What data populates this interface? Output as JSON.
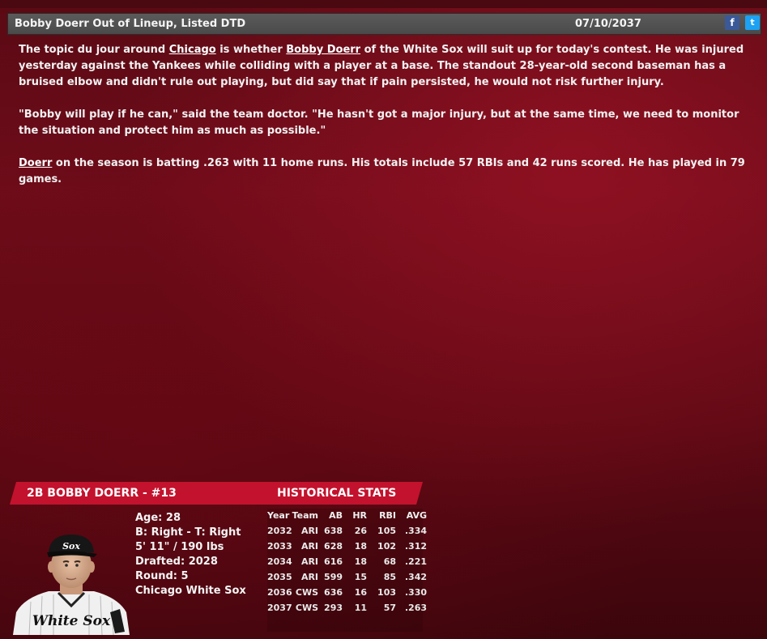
{
  "headline": {
    "title": "Bobby Doerr Out of Lineup, Listed DTD",
    "date": "07/10/2037",
    "facebook_icon": "f",
    "twitter_icon": "t"
  },
  "article": {
    "p1_a": "The topic du jour around ",
    "p1_link1": "Chicago",
    "p1_b": " is whether ",
    "p1_link2": "Bobby Doerr",
    "p1_c": " of the White Sox will suit up for today's contest. He was injured yesterday against the Yankees while colliding with a player at a base. The standout 28-year-old second baseman has a bruised elbow and didn't rule out playing, but did say that if pain persisted, he would not risk further injury.",
    "p2": "\"Bobby will play if he can,\" said the team doctor. \"He hasn't got a major injury, but at the same time, we need to monitor the situation and protect him as much as possible.\"",
    "p3_link": "Doerr",
    "p3_rest": " on the season is batting .263 with 11 home runs. His totals include 57 RBIs and 42 runs scored. He has played in 79 games."
  },
  "player_card": {
    "name_header": "2B BOBBY DOERR - #13",
    "stats_header": "HISTORICAL STATS",
    "bio": {
      "age": "Age: 28",
      "bats_throws": "B: Right - T: Right",
      "height_weight": "5' 11\" / 190 lbs",
      "drafted": "Drafted: 2028",
      "round": "Round: 5",
      "team": "Chicago White Sox"
    },
    "cap_logo": "Sox",
    "jersey_text": "White Sox",
    "stats_columns": [
      "Year",
      "Team",
      "AB",
      "HR",
      "RBI",
      "AVG"
    ],
    "stats_rows": [
      [
        "2032",
        "ARI",
        "638",
        "26",
        "105",
        ".334"
      ],
      [
        "2033",
        "ARI",
        "628",
        "18",
        "102",
        ".312"
      ],
      [
        "2034",
        "ARI",
        "616",
        "18",
        "68",
        ".221"
      ],
      [
        "2035",
        "ARI",
        "599",
        "15",
        "85",
        ".342"
      ],
      [
        "2036",
        "CWS",
        "636",
        "16",
        "103",
        ".330"
      ],
      [
        "2037",
        "CWS",
        "293",
        "11",
        "57",
        ".263"
      ]
    ]
  },
  "colors": {
    "background": "#6e0c1a",
    "header_bar": "#4a4a4a",
    "card_accent": "#c3122d",
    "facebook": "#3b5998",
    "twitter": "#1da1f2"
  }
}
